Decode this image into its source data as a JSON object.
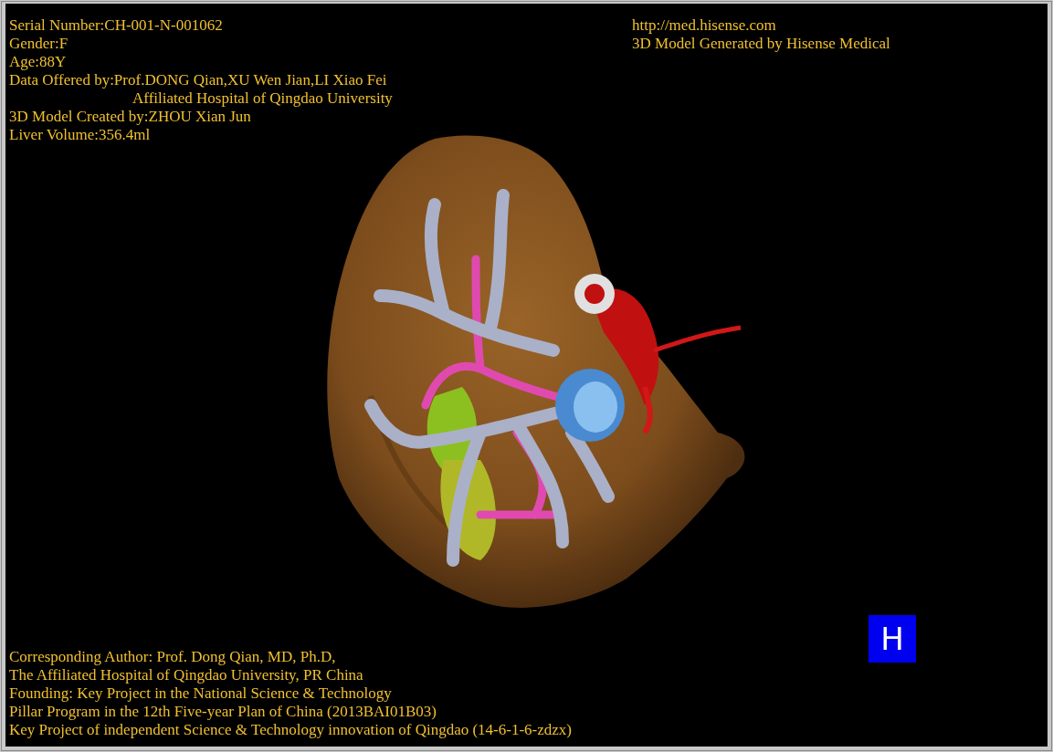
{
  "top_left_info": [
    {
      "kind": "line",
      "text": "Serial Number:CH-001-N-001062"
    },
    {
      "kind": "line",
      "text": "Gender:F"
    },
    {
      "kind": "line",
      "text": "Age:88Y"
    },
    {
      "kind": "line",
      "text": "Data Offered by:Prof.DONG Qian,XU Wen Jian,LI Xiao Fei"
    },
    {
      "kind": "continuation",
      "text": "Affiliated Hospital of Qingdao University"
    },
    {
      "kind": "line",
      "text": "3D Model Created by:ZHOU Xian Jun"
    },
    {
      "kind": "line",
      "text": "Liver Volume:356.4ml"
    }
  ],
  "top_right_info": [
    {
      "text": "http://med.hisense.com"
    },
    {
      "text": "3D Model Generated by Hisense Medical"
    }
  ],
  "bottom_info": [
    {
      "text": "Corresponding Author: Prof. Dong Qian, MD, Ph.D,"
    },
    {
      "text": "The Affiliated Hospital of Qingdao University, PR China"
    },
    {
      "text": "Founding: Key Project in the National Science & Technology"
    },
    {
      "text": "Pillar Program in the 12th Five-year Plan of China (2013BAI01B03)"
    },
    {
      "text": "Key Project of independent Science & Technology innovation of Qingdao (14-6-1-6-zdzx)"
    }
  ],
  "view_button": {
    "label": "H"
  }
}
